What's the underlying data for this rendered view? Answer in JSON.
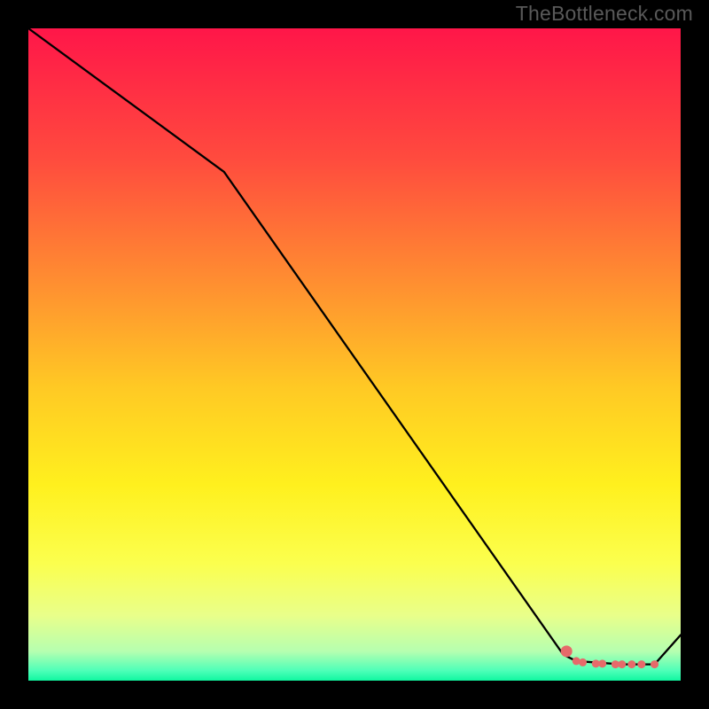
{
  "watermark": "TheBottleneck.com",
  "chart_data": {
    "type": "line",
    "title": "",
    "xlabel": "",
    "ylabel": "",
    "xlim": [
      0,
      100
    ],
    "ylim": [
      0,
      100
    ],
    "grid": false,
    "series": [
      {
        "name": "curve",
        "x": [
          0,
          30,
          82,
          84,
          91,
          92.5,
          96,
          100
        ],
        "values": [
          100,
          78,
          4,
          3,
          2.5,
          2.5,
          2.5,
          7
        ]
      }
    ],
    "markers": {
      "name": "highlight",
      "color": "#e66a6a",
      "points": [
        {
          "x": 82.5,
          "y": 4.5
        },
        {
          "x": 84,
          "y": 3.0
        },
        {
          "x": 85,
          "y": 2.8
        },
        {
          "x": 87,
          "y": 2.6
        },
        {
          "x": 88,
          "y": 2.6
        },
        {
          "x": 90,
          "y": 2.5
        },
        {
          "x": 91,
          "y": 2.5
        },
        {
          "x": 92.5,
          "y": 2.5
        },
        {
          "x": 94,
          "y": 2.5
        },
        {
          "x": 96,
          "y": 2.5
        }
      ]
    },
    "gradient_stops": [
      {
        "offset": 0.0,
        "color": "#ff1649"
      },
      {
        "offset": 0.2,
        "color": "#ff4b3e"
      },
      {
        "offset": 0.4,
        "color": "#ff9230"
      },
      {
        "offset": 0.55,
        "color": "#ffc924"
      },
      {
        "offset": 0.7,
        "color": "#fff01e"
      },
      {
        "offset": 0.82,
        "color": "#fbff4e"
      },
      {
        "offset": 0.9,
        "color": "#e9ff8a"
      },
      {
        "offset": 0.955,
        "color": "#b6ffb0"
      },
      {
        "offset": 0.985,
        "color": "#4dffb8"
      },
      {
        "offset": 1.0,
        "color": "#10f7a0"
      }
    ]
  }
}
